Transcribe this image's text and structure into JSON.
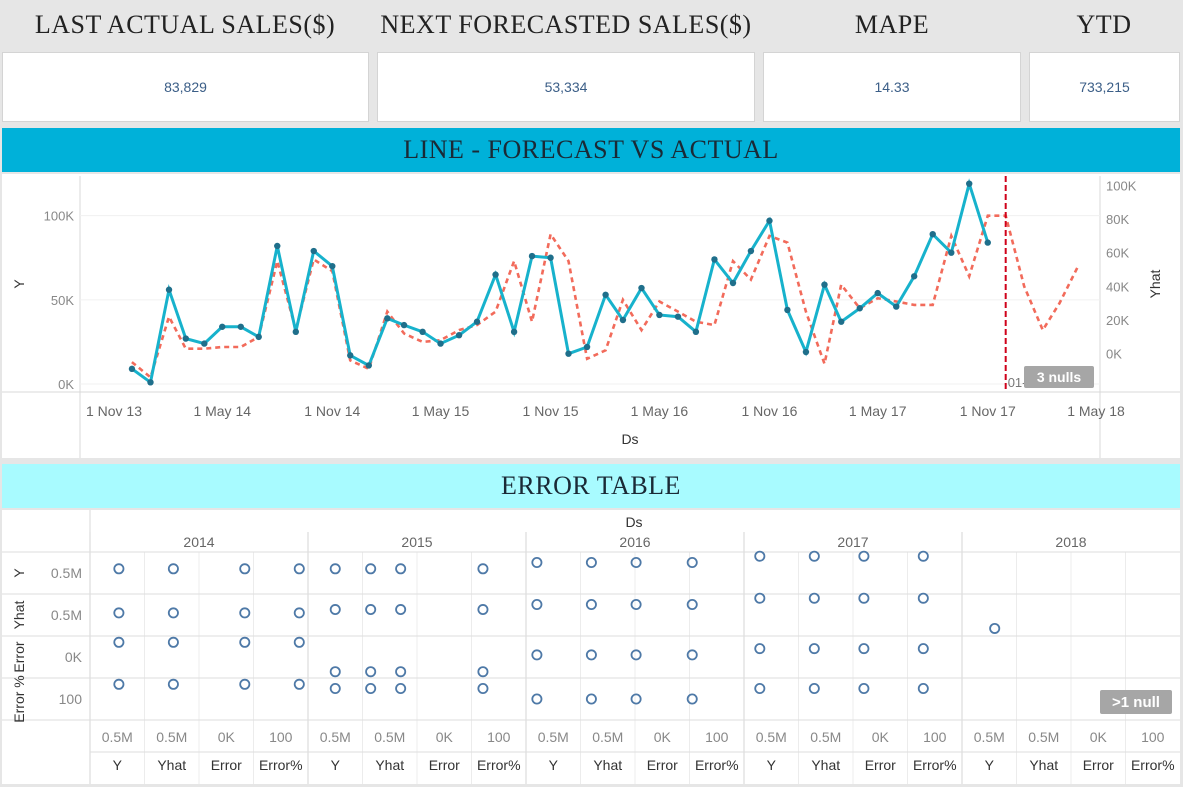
{
  "kpis": [
    {
      "title": "LAST ACTUAL SALES($)",
      "value": "83,829"
    },
    {
      "title": "NEXT FORECASTED SALES($)",
      "value": "53,334"
    },
    {
      "title": "MAPE",
      "value": "14.33"
    },
    {
      "title": "YTD",
      "value": "733,215"
    }
  ],
  "line_section": {
    "title": "LINE - FORECAST VS ACTUAL",
    "band_color": "#00b1d9"
  },
  "error_section": {
    "title": "ERROR TABLE",
    "band_color": "#a8fbff"
  },
  "chart_data": [
    {
      "type": "line",
      "xlabel": "Ds",
      "ylabel": "Y",
      "y2label": "Yhat",
      "x_ticks": [
        "1 Nov 13",
        "1 May 14",
        "1 Nov 14",
        "1 May 15",
        "1 Nov 15",
        "1 May 16",
        "1 Nov 16",
        "1 May 17",
        "1 Nov 17",
        "1 May 18"
      ],
      "y_ticks": [
        "0K",
        "50K",
        "100K"
      ],
      "y2_ticks": [
        "0K",
        "20K",
        "40K",
        "60K",
        "80K",
        "100K"
      ],
      "ylim": [
        0,
        120000
      ],
      "y2lim": [
        -18000,
        102000
      ],
      "x_range": [
        "2013-11-01",
        "2018-05-01"
      ],
      "forecast_marker": {
        "date": "2017-12-01",
        "label": "01-12-2017"
      },
      "nulls_badge": "3 nulls",
      "colors": {
        "actual": "#17b2cc",
        "forecast": "#f26b5b",
        "marker": "#d0021b"
      },
      "series": [
        {
          "key": "actual",
          "dates": [
            "2013-12-01",
            "2014-01-01",
            "2014-02-01",
            "2014-03-01",
            "2014-04-01",
            "2014-05-01",
            "2014-06-01",
            "2014-07-01",
            "2014-08-01",
            "2014-09-01",
            "2014-10-01",
            "2014-11-01",
            "2014-12-01",
            "2015-01-01",
            "2015-02-01",
            "2015-03-01",
            "2015-04-01",
            "2015-05-01",
            "2015-06-01",
            "2015-07-01",
            "2015-08-01",
            "2015-09-01",
            "2015-10-01",
            "2015-11-01",
            "2015-12-01",
            "2016-01-01",
            "2016-02-01",
            "2016-03-01",
            "2016-04-01",
            "2016-05-01",
            "2016-06-01",
            "2016-07-01",
            "2016-08-01",
            "2016-09-01",
            "2016-10-01",
            "2016-11-01",
            "2016-12-01",
            "2017-01-01",
            "2017-02-01",
            "2017-03-01",
            "2017-04-01",
            "2017-05-01",
            "2017-06-01",
            "2017-07-01",
            "2017-08-01",
            "2017-09-01",
            "2017-10-01",
            "2017-11-01",
            "2017-12-01"
          ],
          "values": [
            9000,
            1000,
            56000,
            27000,
            24000,
            34000,
            34000,
            28000,
            82000,
            31000,
            79000,
            70000,
            17000,
            11000,
            39000,
            35000,
            31000,
            24000,
            29000,
            37000,
            65000,
            31000,
            76000,
            75000,
            18000,
            22000,
            53000,
            38000,
            57000,
            41000,
            40000,
            31000,
            74000,
            60000,
            79000,
            97000,
            44000,
            19000,
            59000,
            37000,
            45000,
            54000,
            46000,
            64000,
            89000,
            78000,
            119000,
            84000
          ]
        },
        {
          "key": "forecast",
          "dates": [
            "2013-12-01",
            "2014-01-01",
            "2014-02-01",
            "2014-03-01",
            "2014-04-01",
            "2014-05-01",
            "2014-06-01",
            "2014-07-01",
            "2014-08-01",
            "2014-09-01",
            "2014-10-01",
            "2014-11-01",
            "2014-12-01",
            "2015-01-01",
            "2015-02-01",
            "2015-03-01",
            "2015-04-01",
            "2015-05-01",
            "2015-06-01",
            "2015-07-01",
            "2015-08-01",
            "2015-09-01",
            "2015-10-01",
            "2015-11-01",
            "2015-12-01",
            "2016-01-01",
            "2016-02-01",
            "2016-03-01",
            "2016-04-01",
            "2016-05-01",
            "2016-06-01",
            "2016-07-01",
            "2016-08-01",
            "2016-09-01",
            "2016-10-01",
            "2016-11-01",
            "2016-12-01",
            "2017-01-01",
            "2017-02-01",
            "2017-03-01",
            "2017-04-01",
            "2017-05-01",
            "2017-06-01",
            "2017-07-01",
            "2017-08-01",
            "2017-09-01",
            "2017-10-01",
            "2017-11-01",
            "2017-12-01",
            "2018-01-01",
            "2018-02-01",
            "2018-03-01",
            "2018-04-01"
          ],
          "values": [
            -5000,
            -14000,
            22000,
            3000,
            3000,
            4000,
            4000,
            10000,
            55000,
            14000,
            56000,
            49000,
            -4000,
            -9000,
            25000,
            12000,
            7000,
            8000,
            14000,
            17000,
            25000,
            55000,
            19000,
            71000,
            55000,
            -3000,
            2000,
            32000,
            14000,
            31000,
            25000,
            19000,
            17000,
            55000,
            44000,
            70000,
            66000,
            25000,
            -6000,
            41000,
            27000,
            33000,
            31000,
            29000,
            29000,
            70000,
            46000,
            82000,
            82000,
            40000,
            14000,
            30000,
            52000
          ]
        }
      ]
    },
    {
      "type": "scatter",
      "title": "Ds",
      "row_labels": [
        {
          "label": "Y",
          "tick": "0.5M"
        },
        {
          "label": "Yhat",
          "tick": "0.5M"
        },
        {
          "label": "Error",
          "tick": "0K"
        },
        {
          "label": "Error %",
          "tick": "100"
        }
      ],
      "years": [
        "2014",
        "2015",
        "2016",
        "2017",
        "2018"
      ],
      "columns": [
        "Y",
        "Yhat",
        "Error",
        "Error%"
      ],
      "col_ticks": [
        "0.5M",
        "0.5M",
        "0K",
        "100"
      ],
      "null_badge": ">1 null",
      "point_color": "#4e79a7",
      "note": "each point value given as fraction of cell extent (x within column, y within row)",
      "points": [
        {
          "year": 0,
          "col": 0,
          "row": 0,
          "x": 0.53,
          "y": 0.4
        },
        {
          "year": 0,
          "col": 1,
          "row": 0,
          "x": 0.53,
          "y": 0.4
        },
        {
          "year": 0,
          "col": 2,
          "row": 0,
          "x": 0.84,
          "y": 0.4
        },
        {
          "year": 0,
          "col": 3,
          "row": 0,
          "x": 0.84,
          "y": 0.4
        },
        {
          "year": 0,
          "col": 0,
          "row": 1,
          "x": 0.53,
          "y": 0.45
        },
        {
          "year": 0,
          "col": 1,
          "row": 1,
          "x": 0.53,
          "y": 0.45
        },
        {
          "year": 0,
          "col": 2,
          "row": 1,
          "x": 0.84,
          "y": 0.45
        },
        {
          "year": 0,
          "col": 3,
          "row": 1,
          "x": 0.84,
          "y": 0.45
        },
        {
          "year": 0,
          "col": 0,
          "row": 2,
          "x": 0.53,
          "y": 0.15
        },
        {
          "year": 0,
          "col": 1,
          "row": 2,
          "x": 0.53,
          "y": 0.15
        },
        {
          "year": 0,
          "col": 2,
          "row": 2,
          "x": 0.84,
          "y": 0.15
        },
        {
          "year": 0,
          "col": 3,
          "row": 2,
          "x": 0.84,
          "y": 0.15
        },
        {
          "year": 0,
          "col": 0,
          "row": 3,
          "x": 0.53,
          "y": 0.15
        },
        {
          "year": 0,
          "col": 1,
          "row": 3,
          "x": 0.53,
          "y": 0.15
        },
        {
          "year": 0,
          "col": 2,
          "row": 3,
          "x": 0.84,
          "y": 0.15
        },
        {
          "year": 0,
          "col": 3,
          "row": 3,
          "x": 0.84,
          "y": 0.15
        },
        {
          "year": 1,
          "col": 0,
          "row": 0,
          "x": 0.5,
          "y": 0.4
        },
        {
          "year": 1,
          "col": 1,
          "row": 0,
          "x": 0.15,
          "y": 0.4
        },
        {
          "year": 1,
          "col": 1,
          "row": 0,
          "x": 0.7,
          "y": 0.4
        },
        {
          "year": 1,
          "col": 3,
          "row": 0,
          "x": 0.21,
          "y": 0.4
        },
        {
          "year": 1,
          "col": 0,
          "row": 1,
          "x": 0.5,
          "y": 0.37
        },
        {
          "year": 1,
          "col": 1,
          "row": 1,
          "x": 0.15,
          "y": 0.37
        },
        {
          "year": 1,
          "col": 1,
          "row": 1,
          "x": 0.7,
          "y": 0.37
        },
        {
          "year": 1,
          "col": 3,
          "row": 1,
          "x": 0.21,
          "y": 0.37
        },
        {
          "year": 1,
          "col": 0,
          "row": 2,
          "x": 0.5,
          "y": 0.85
        },
        {
          "year": 1,
          "col": 1,
          "row": 2,
          "x": 0.15,
          "y": 0.85
        },
        {
          "year": 1,
          "col": 1,
          "row": 2,
          "x": 0.7,
          "y": 0.85
        },
        {
          "year": 1,
          "col": 3,
          "row": 2,
          "x": 0.21,
          "y": 0.85
        },
        {
          "year": 1,
          "col": 0,
          "row": 3,
          "x": 0.5,
          "y": 0.25
        },
        {
          "year": 1,
          "col": 1,
          "row": 3,
          "x": 0.15,
          "y": 0.25
        },
        {
          "year": 1,
          "col": 1,
          "row": 3,
          "x": 0.7,
          "y": 0.25
        },
        {
          "year": 1,
          "col": 3,
          "row": 3,
          "x": 0.21,
          "y": 0.25
        },
        {
          "year": 2,
          "col": 0,
          "row": 0,
          "x": 0.2,
          "y": 0.25
        },
        {
          "year": 2,
          "col": 1,
          "row": 0,
          "x": 0.2,
          "y": 0.25
        },
        {
          "year": 2,
          "col": 2,
          "row": 0,
          "x": 0.02,
          "y": 0.25
        },
        {
          "year": 2,
          "col": 3,
          "row": 0,
          "x": 0.05,
          "y": 0.25
        },
        {
          "year": 2,
          "col": 0,
          "row": 1,
          "x": 0.2,
          "y": 0.25
        },
        {
          "year": 2,
          "col": 1,
          "row": 1,
          "x": 0.2,
          "y": 0.25
        },
        {
          "year": 2,
          "col": 2,
          "row": 1,
          "x": 0.02,
          "y": 0.25
        },
        {
          "year": 2,
          "col": 3,
          "row": 1,
          "x": 0.05,
          "y": 0.25
        },
        {
          "year": 2,
          "col": 0,
          "row": 2,
          "x": 0.2,
          "y": 0.45
        },
        {
          "year": 2,
          "col": 1,
          "row": 2,
          "x": 0.2,
          "y": 0.45
        },
        {
          "year": 2,
          "col": 2,
          "row": 2,
          "x": 0.02,
          "y": 0.45
        },
        {
          "year": 2,
          "col": 3,
          "row": 2,
          "x": 0.05,
          "y": 0.45
        },
        {
          "year": 2,
          "col": 0,
          "row": 3,
          "x": 0.2,
          "y": 0.5
        },
        {
          "year": 2,
          "col": 1,
          "row": 3,
          "x": 0.2,
          "y": 0.5
        },
        {
          "year": 2,
          "col": 2,
          "row": 3,
          "x": 0.02,
          "y": 0.5
        },
        {
          "year": 2,
          "col": 3,
          "row": 3,
          "x": 0.05,
          "y": 0.5
        },
        {
          "year": 3,
          "col": 0,
          "row": 0,
          "x": 0.29,
          "y": 0.1
        },
        {
          "year": 3,
          "col": 1,
          "row": 0,
          "x": 0.29,
          "y": 0.1
        },
        {
          "year": 3,
          "col": 2,
          "row": 0,
          "x": 0.2,
          "y": 0.1
        },
        {
          "year": 3,
          "col": 3,
          "row": 0,
          "x": 0.29,
          "y": 0.1
        },
        {
          "year": 3,
          "col": 0,
          "row": 1,
          "x": 0.29,
          "y": 0.1
        },
        {
          "year": 3,
          "col": 1,
          "row": 1,
          "x": 0.29,
          "y": 0.1
        },
        {
          "year": 3,
          "col": 2,
          "row": 1,
          "x": 0.2,
          "y": 0.1
        },
        {
          "year": 3,
          "col": 3,
          "row": 1,
          "x": 0.29,
          "y": 0.1
        },
        {
          "year": 3,
          "col": 0,
          "row": 2,
          "x": 0.29,
          "y": 0.3
        },
        {
          "year": 3,
          "col": 1,
          "row": 2,
          "x": 0.29,
          "y": 0.3
        },
        {
          "year": 3,
          "col": 2,
          "row": 2,
          "x": 0.2,
          "y": 0.3
        },
        {
          "year": 3,
          "col": 3,
          "row": 2,
          "x": 0.29,
          "y": 0.3
        },
        {
          "year": 3,
          "col": 0,
          "row": 3,
          "x": 0.29,
          "y": 0.25
        },
        {
          "year": 3,
          "col": 1,
          "row": 3,
          "x": 0.29,
          "y": 0.25
        },
        {
          "year": 3,
          "col": 2,
          "row": 3,
          "x": 0.2,
          "y": 0.25
        },
        {
          "year": 3,
          "col": 3,
          "row": 3,
          "x": 0.29,
          "y": 0.25
        },
        {
          "year": 4,
          "col": 0,
          "row": 1,
          "x": 0.6,
          "y": 0.82
        }
      ]
    }
  ]
}
